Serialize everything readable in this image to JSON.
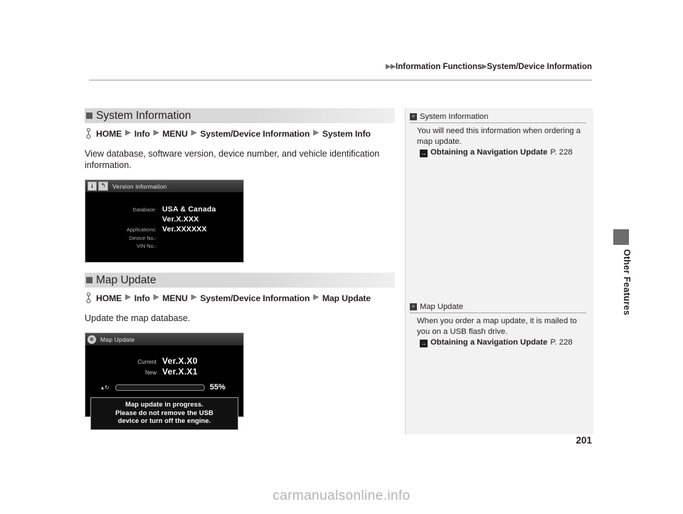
{
  "header": {
    "crumb1": "Information Functions",
    "crumb2": "System/Device Information",
    "triangle": "▶"
  },
  "page_number": "201",
  "edge_tab_label": "Other Features",
  "watermark": "carmanualsonline.info",
  "sections": [
    {
      "heading": "System Information",
      "nav_path": [
        "HOME",
        "Info",
        "MENU",
        "System/Device Information",
        "System Info"
      ],
      "description": "View database, software version, device number, and vehicle identification information.",
      "device": {
        "title": "Version information",
        "icon_info": "i",
        "icon_back": "↰",
        "rows": [
          {
            "label": "Database:",
            "value": "USA & Canada"
          },
          {
            "label": "",
            "value": "Ver.X.XXX"
          },
          {
            "label": "Applications:",
            "value": "Ver.XXXXXX"
          },
          {
            "label": "Device No.:",
            "value": ""
          },
          {
            "label": "VIN No.:",
            "value": ""
          }
        ]
      }
    },
    {
      "heading": "Map Update",
      "nav_path": [
        "HOME",
        "Info",
        "MENU",
        "System/Device Information",
        "Map Update"
      ],
      "description": "Update the map database.",
      "device": {
        "title": "Map Update",
        "icon_globe": "⊕",
        "rows": [
          {
            "label": "Current",
            "value": "Ver.X.X0"
          },
          {
            "label": "New",
            "value": "Ver.X.X1"
          }
        ],
        "progress": {
          "icons": "▴↻",
          "percent_label": "55%",
          "percent_value": 55
        },
        "message_lines": [
          "Map update in progress.",
          "Please do not remove the USB",
          "device or turn off the engine."
        ]
      }
    }
  ],
  "notes": [
    {
      "title": "System Information",
      "body": "You will need this information when ordering a map update.",
      "ref_title": "Obtaining a Navigation Update",
      "ref_page": "P. 228"
    },
    {
      "title": "Map Update",
      "body": "When you order a map update, it is mailed to you on a USB flash drive.",
      "ref_title": "Obtaining a Navigation Update",
      "ref_page": "P. 228"
    }
  ]
}
